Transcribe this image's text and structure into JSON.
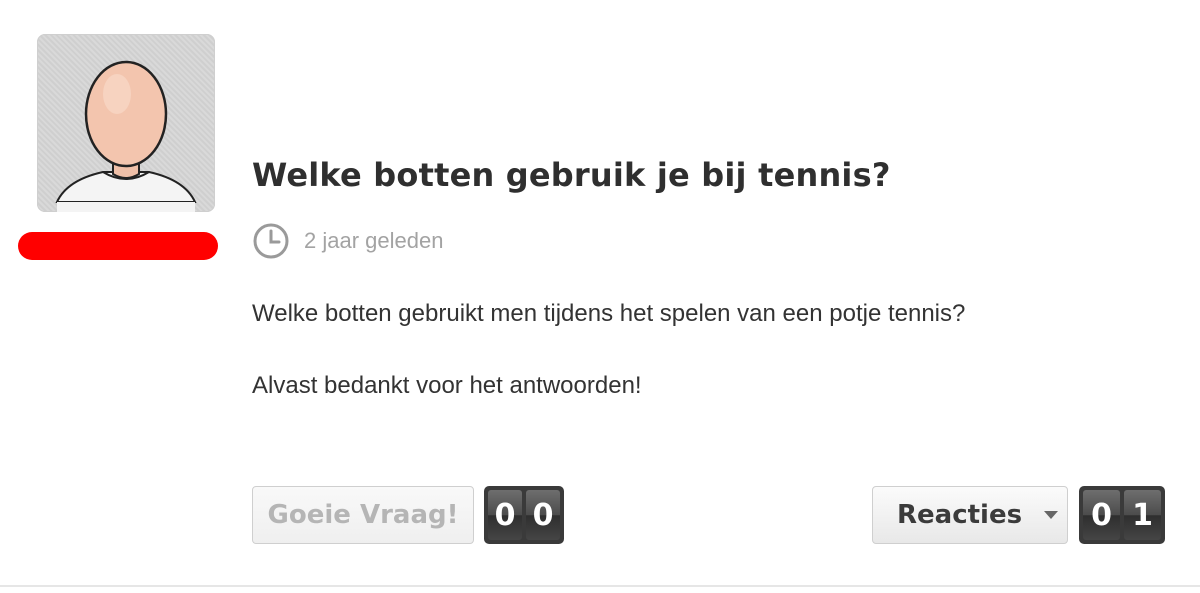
{
  "question": {
    "title": "Welke botten gebruik je bij tennis?",
    "time_ago": "2 jaar geleden",
    "body": [
      "Welke botten gebruikt men tijdens het spelen van een potje tennis?",
      "Alvast bedankt voor het antwoorden!"
    ]
  },
  "actions": {
    "good_question_label": "Goeie Vraag!",
    "good_question_count": [
      "0",
      "0"
    ],
    "reactions_label": "Reacties",
    "reactions_count": [
      "0",
      "1"
    ]
  },
  "colors": {
    "user_bar": "#ff0000",
    "title": "#2f2f2f",
    "meta": "#a3a3a3"
  },
  "icons": {
    "avatar": "default-user-avatar",
    "clock": "clock-icon",
    "caret": "caret-down-icon"
  }
}
